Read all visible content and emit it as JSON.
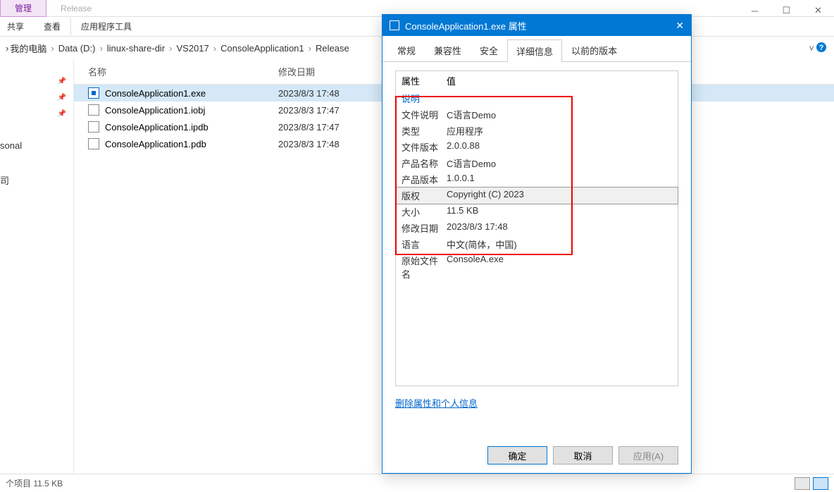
{
  "explorer": {
    "top_tabs": {
      "manage": "管理",
      "release": "Release",
      "app_tools": "应用程序工具"
    },
    "toolbar": {
      "share": "共享",
      "view": "查看"
    },
    "breadcrumb": [
      "我的电脑",
      "Data (D:)",
      "linux-share-dir",
      "VS2017",
      "ConsoleApplication1",
      "Release"
    ],
    "columns": {
      "name": "名称",
      "date": "修改日期"
    },
    "files": [
      {
        "name": "ConsoleApplication1.exe",
        "date": "2023/8/3 17:48",
        "type": "exe",
        "selected": true
      },
      {
        "name": "ConsoleApplication1.iobj",
        "date": "2023/8/3 17:47",
        "type": "file",
        "selected": false
      },
      {
        "name": "ConsoleApplication1.ipdb",
        "date": "2023/8/3 17:47",
        "type": "file",
        "selected": false
      },
      {
        "name": "ConsoleApplication1.pdb",
        "date": "2023/8/3 17:48",
        "type": "file",
        "selected": false
      }
    ],
    "sidebar": {
      "personal": "sonal",
      "lib": "司"
    },
    "status": "个项目  11.5 KB"
  },
  "dialog": {
    "title": "ConsoleApplication1.exe 属性",
    "tabs": [
      "常规",
      "兼容性",
      "安全",
      "详细信息",
      "以前的版本"
    ],
    "active_tab": "详细信息",
    "header_k": "属性",
    "header_v": "值",
    "desc_label": "说明",
    "props": [
      {
        "k": "文件说明",
        "v": "C语言Demo"
      },
      {
        "k": "类型",
        "v": "应用程序"
      },
      {
        "k": "文件版本",
        "v": "2.0.0.88"
      },
      {
        "k": "产品名称",
        "v": "C语言Demo"
      },
      {
        "k": "产品版本",
        "v": "1.0.0.1"
      },
      {
        "k": "版权",
        "v": "Copyright (C) 2023",
        "selected": true
      },
      {
        "k": "大小",
        "v": "11.5 KB"
      },
      {
        "k": "修改日期",
        "v": "2023/8/3 17:48"
      },
      {
        "k": "语言",
        "v": "中文(简体，中国)"
      },
      {
        "k": "原始文件名",
        "v": "ConsoleA.exe"
      }
    ],
    "delete_link": "删除属性和个人信息",
    "buttons": {
      "ok": "确定",
      "cancel": "取消",
      "apply": "应用(A)"
    }
  }
}
